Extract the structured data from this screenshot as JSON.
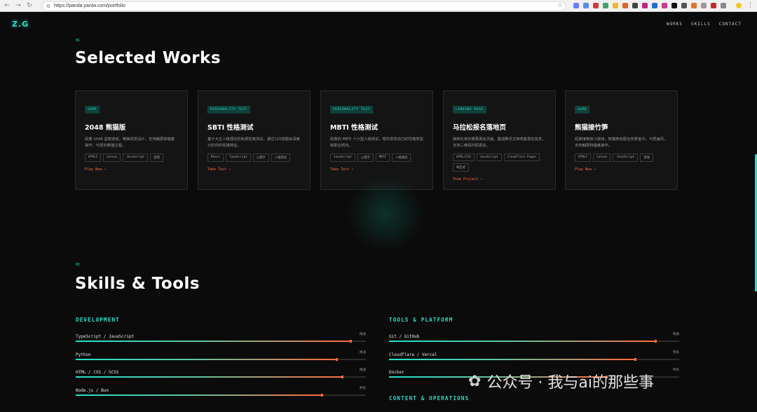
{
  "browser": {
    "url": "https://panda.yaniw.com/portfolio"
  },
  "header": {
    "logo": "Z.G",
    "nav": [
      "WORKS",
      "SKILLS",
      "CONTACT"
    ]
  },
  "works": {
    "number": "01",
    "title": "Selected Works",
    "cards": [
      {
        "badge": "GAME",
        "title": "2048 熊猫版",
        "desc": "经典 2048 益智游戏，精美视觉设计，支持触屏和键盘操作，可爱的熊猫主题。",
        "tags": [
          "HTML5",
          "Canvas",
          "JavaScript",
          "游戏"
        ],
        "link": "Play Now →"
      },
      {
        "badge": "PERSONALITY TEST",
        "title": "SBTI 性格测试",
        "desc": "基于大五人格理论的免费性格测试，通过120道题目深度分析你的性格特征。",
        "tags": [
          "React",
          "TypeScript",
          "心理学",
          "人格测试"
        ],
        "link": "Take Test →"
      },
      {
        "badge": "PERSONALITY TEST",
        "title": "MBTI 性格测试",
        "desc": "经典的 MBTI 十六型人格测试，帮你发现自己的性格类型和职业倾向。",
        "tags": [
          "JavaScript",
          "心理学",
          "MBTI",
          "人格测试"
        ],
        "link": "Take Test →"
      },
      {
        "badge": "LANDING PAGE",
        "title": "马拉松报名落地页",
        "desc": "高转化率的赛事报名页面，集成腾讯文档收集报名信息，支持二维码扫码报名。",
        "tags": [
          "HTML/CSS",
          "JavaScript",
          "Cloudflare Pages",
          "响应式"
        ],
        "link": "View Project →"
      },
      {
        "badge": "GAME",
        "title": "熊猫接竹笋",
        "desc": "经典接物体小游戏，熊猫角色配合背景音乐，可爱画风，支持触屏和键盘操作。",
        "tags": [
          "HTML5",
          "Canvas",
          "JavaScript",
          "游戏"
        ],
        "link": "Play Now →"
      }
    ]
  },
  "skills": {
    "number": "02",
    "title": "Skills & Tools",
    "categories": [
      {
        "name": "DEVELOPMENT",
        "items": [
          {
            "name": "TypeScript / JavaScript",
            "level": "精通",
            "percent": 95
          },
          {
            "name": "Python",
            "level": "精通",
            "percent": 90
          },
          {
            "name": "HTML / CSS / SCSS",
            "level": "精通",
            "percent": 92
          },
          {
            "name": "Node.js / Bun",
            "level": "熟练",
            "percent": 85
          }
        ]
      },
      {
        "name": "TOOLS & PLATFORM",
        "items": [
          {
            "name": "Git / GitHub",
            "level": "精通",
            "percent": 92
          },
          {
            "name": "Cloudflare / Vercel",
            "level": "熟练",
            "percent": 85
          },
          {
            "name": "Docker",
            "level": "熟练",
            "percent": 75
          }
        ]
      },
      {
        "name": "CONTENT & OPERATIONS",
        "items": []
      }
    ]
  },
  "watermark": "公众号 · 我与ai的那些事",
  "colors": {
    "accent": "#23e0c8",
    "highlight": "#ff6a3d",
    "background": "#0b0b0b"
  }
}
